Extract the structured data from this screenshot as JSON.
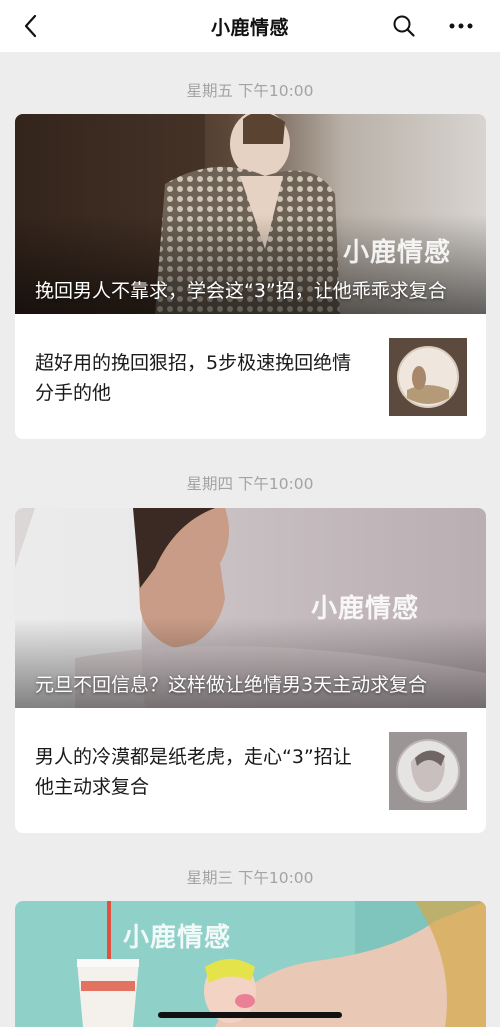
{
  "nav": {
    "title": "小鹿情感",
    "back_icon": "chevron-left-icon",
    "search_icon": "search-icon",
    "more_icon": "more-horizontal-icon"
  },
  "feed": [
    {
      "timestamp": "星期五 下午10:00",
      "hero": {
        "title": "挽回男人不靠求，学会这“3”招，让他乖乖求复合",
        "watermark": "小鹿情感"
      },
      "item": {
        "title": "超好用的挽回狠招，5步极速挽回绝情分手的他"
      }
    },
    {
      "timestamp": "星期四 下午10:00",
      "hero": {
        "title": "元旦不回信息？这样做让绝情男3天主动求复合",
        "watermark": "小鹿情感"
      },
      "item": {
        "title": "男人的冷漠都是纸老虎，走心“3”招让他主动求复合"
      }
    },
    {
      "timestamp": "星期三 下午10:00",
      "hero": {
        "watermark": "小鹿情感"
      }
    }
  ],
  "colors": {
    "background": "#ededed",
    "card": "#ffffff",
    "timestamp": "#a3a3a3"
  }
}
